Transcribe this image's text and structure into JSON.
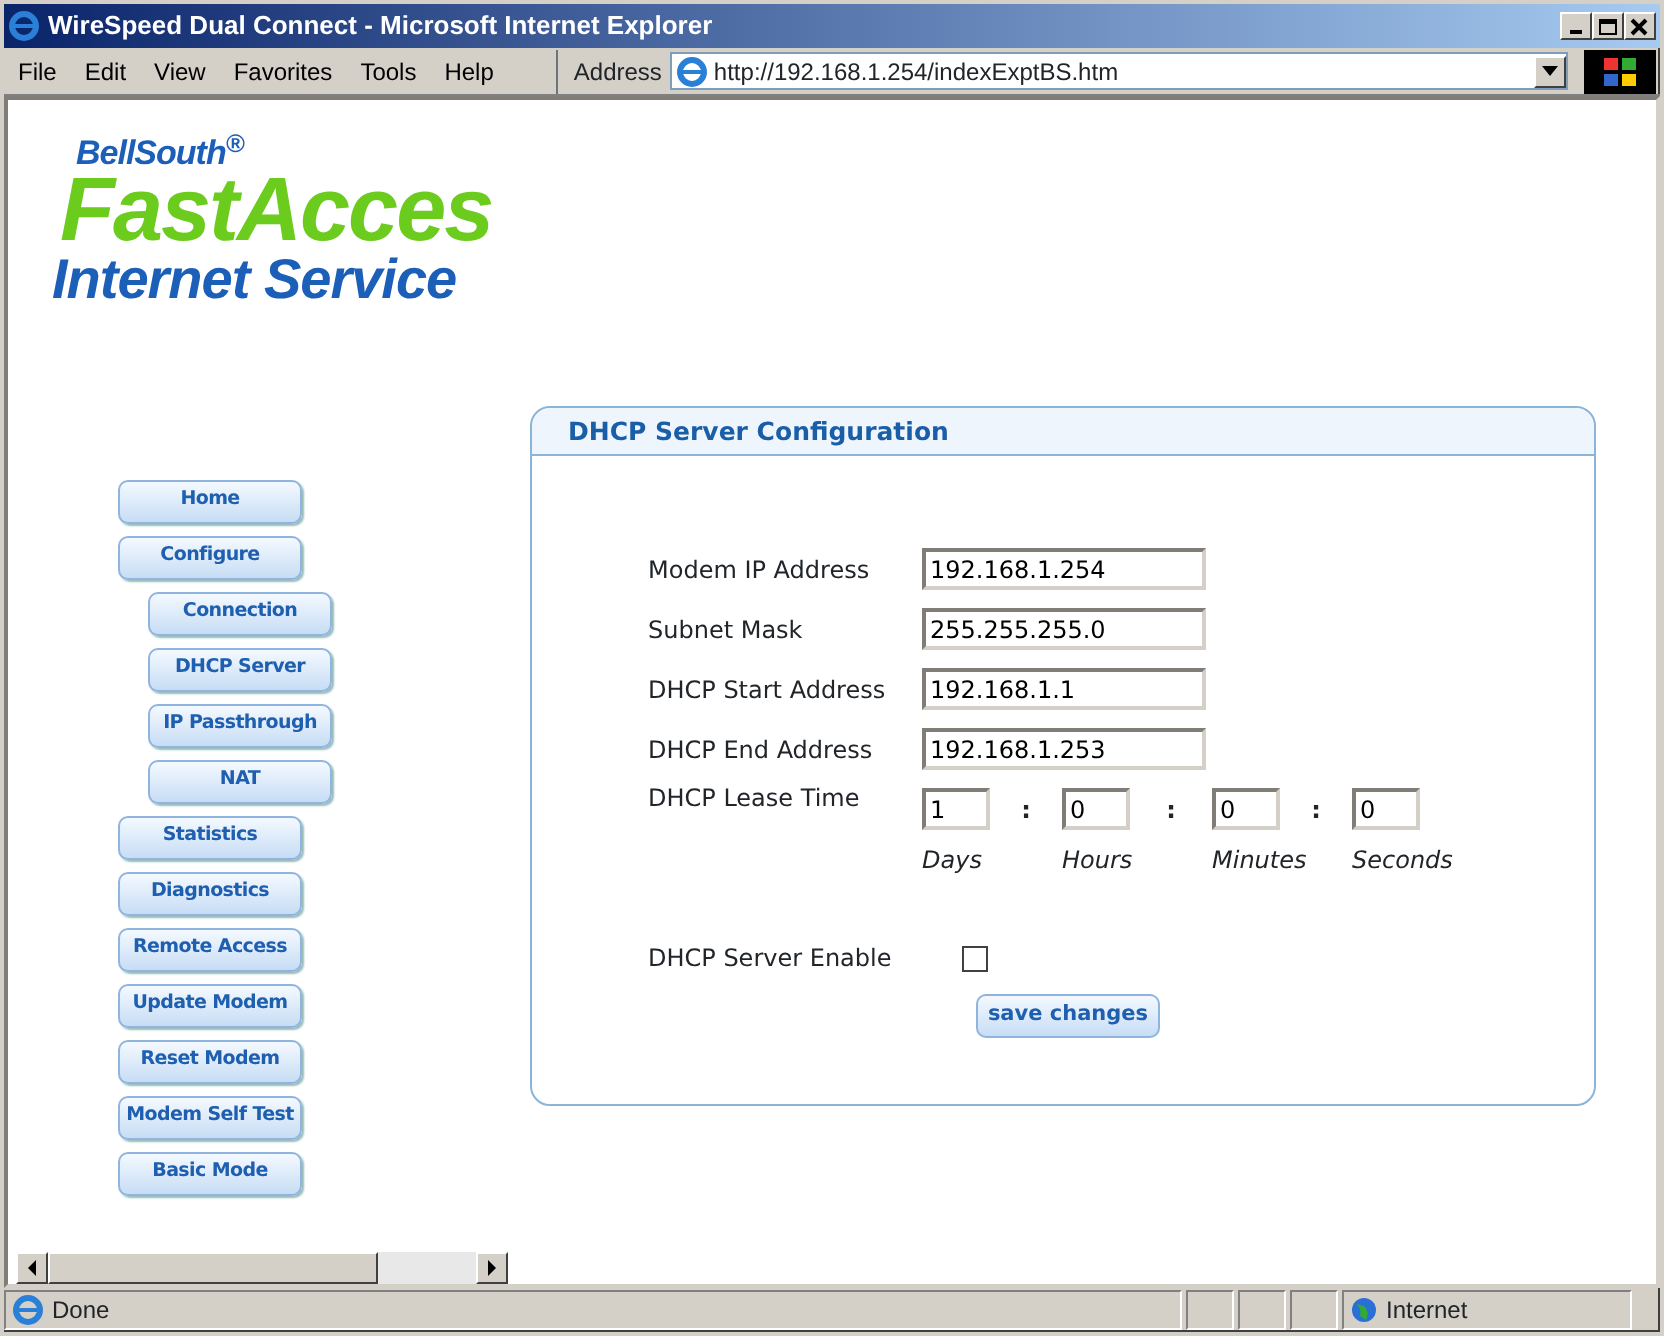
{
  "window": {
    "title": "WireSpeed Dual Connect - Microsoft Internet Explorer"
  },
  "menu": [
    "File",
    "Edit",
    "View",
    "Favorites",
    "Tools",
    "Help"
  ],
  "address": {
    "label": "Address",
    "value": "http://192.168.1.254/indexExptBS.htm"
  },
  "logo": {
    "brand": "BellSouth$^{®}$",
    "product": "FastAcces",
    "tagline": "Internet Service"
  },
  "nav": [
    {
      "label": "Home"
    },
    {
      "label": "Configure",
      "children": [
        {
          "label": "Connection"
        },
        {
          "label": "DHCP Server"
        },
        {
          "label": "IP Passthrough"
        },
        {
          "label": "NAT"
        }
      ]
    },
    {
      "label": "Statistics"
    },
    {
      "label": "Diagnostics"
    },
    {
      "label": "Remote Access"
    },
    {
      "label": "Update Modem"
    },
    {
      "label": "Reset Modem"
    },
    {
      "label": "Modem Self Test"
    },
    {
      "label": "Basic Mode"
    }
  ],
  "panel": {
    "title": "DHCP Server Configuration",
    "fields": [
      {
        "label": "Modem IP Address",
        "value": "192.168.1.254"
      },
      {
        "label": "Subnet Mask",
        "value": "255.255.255.0"
      },
      {
        "label": "DHCP Start Address",
        "value": "192.168.1.1"
      },
      {
        "label": "DHCP End Address",
        "value": "192.168.1.253"
      }
    ],
    "lease": {
      "label": "DHCP Lease Time",
      "separator": ":",
      "parts": [
        {
          "value": "1",
          "unit": "Days"
        },
        {
          "value": "0",
          "unit": "Hours"
        },
        {
          "value": "0",
          "unit": "Minutes"
        },
        {
          "value": "0",
          "unit": "Seconds"
        }
      ]
    },
    "enable": {
      "label": "DHCP Server Enable",
      "checked": false
    },
    "button": "save changes"
  },
  "status_bar": {
    "text": "Done",
    "zone": "Internet"
  }
}
